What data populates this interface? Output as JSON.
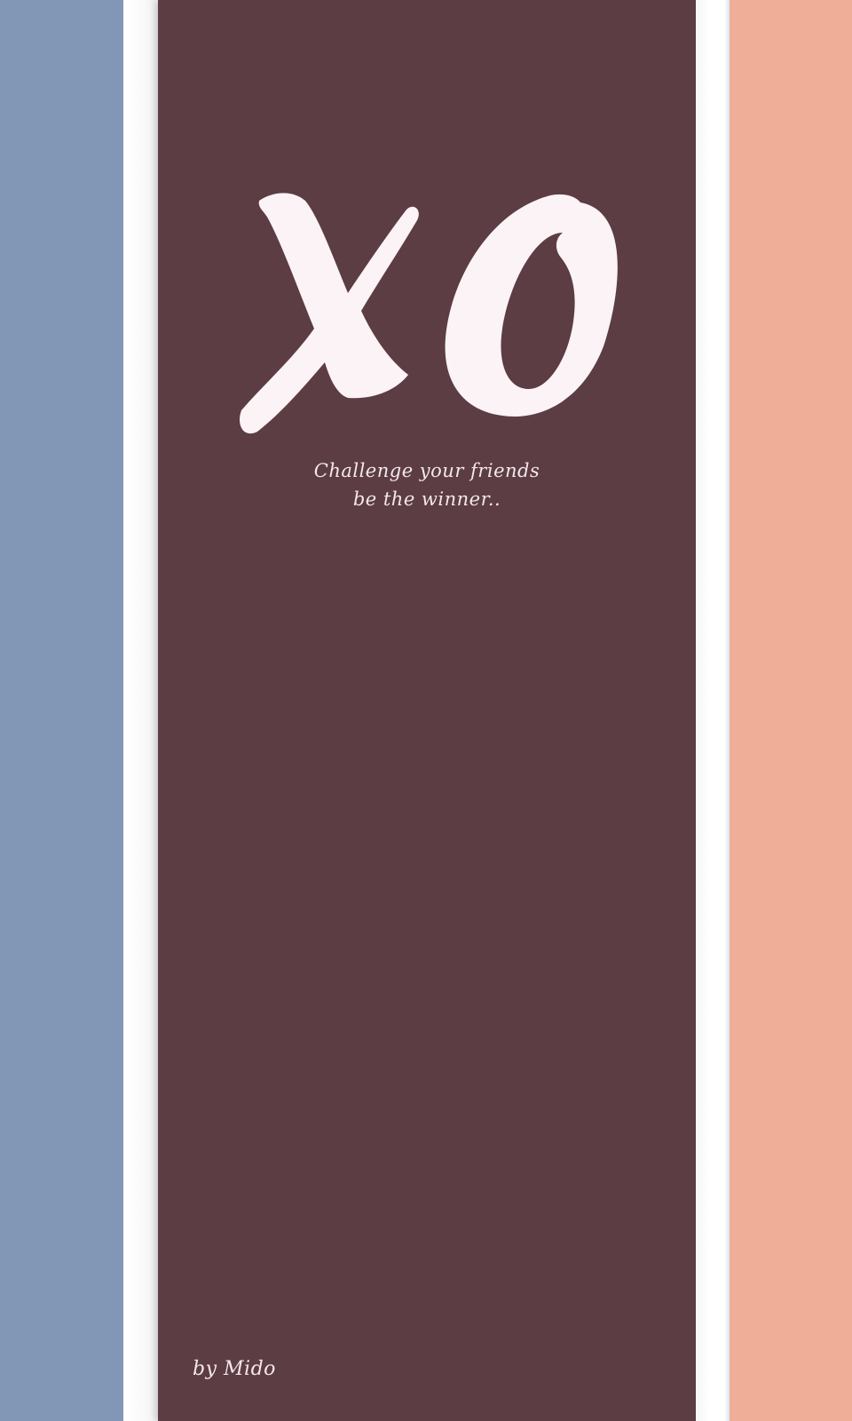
{
  "colors": {
    "left_band": "#8297b5",
    "right_band": "#eeae97",
    "panel": "#5c3d43",
    "logo": "#fbf3f6",
    "text": "#f3e8ec"
  },
  "logo": {
    "text": "XO",
    "icon": "xo-logo-icon"
  },
  "tagline": {
    "line1": "Challenge your friends",
    "line2": "be the winner.."
  },
  "credit": "by Mido"
}
